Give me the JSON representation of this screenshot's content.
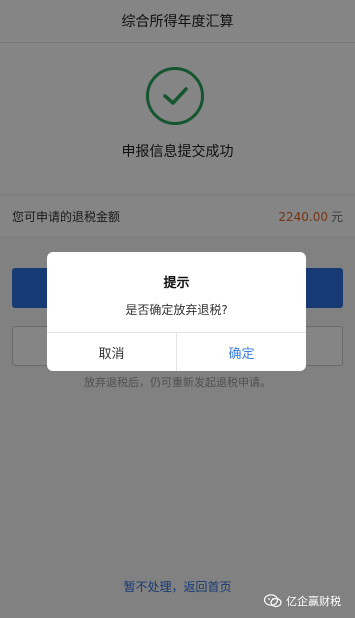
{
  "header": {
    "title": "综合所得年度汇算"
  },
  "success": {
    "message": "申报信息提交成功",
    "accent": "#29a35a"
  },
  "refund": {
    "label": "您可申请的退税金额",
    "amount": "2240.00",
    "unit": "元"
  },
  "buttons": {
    "primary_label": "",
    "secondary_label": ""
  },
  "hint": {
    "text": "放弃退税后，仍可重新发起退税申请。"
  },
  "footer": {
    "back_link": "暂不处理，返回首页"
  },
  "dialog": {
    "title": "提示",
    "message": "是否确定放弃退税?",
    "cancel_label": "取消",
    "confirm_label": "确定"
  },
  "watermark": {
    "text": "亿企赢财税"
  },
  "colors": {
    "primary": "#2e6fde",
    "amount": "#e0672c",
    "link": "#3b7ddd"
  }
}
